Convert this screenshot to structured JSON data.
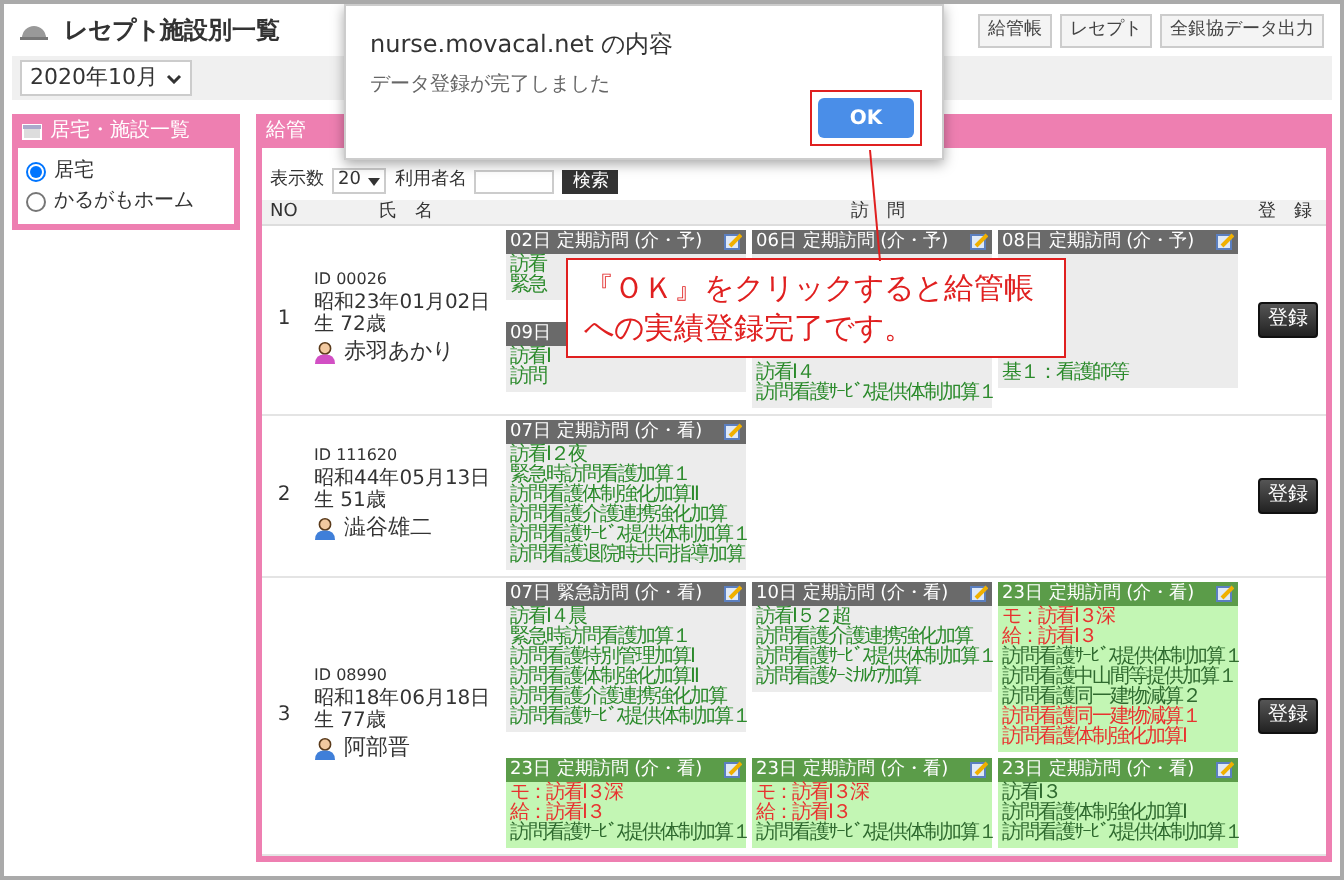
{
  "page": {
    "title": "レセプト施設別一覧",
    "header_buttons": [
      "給管帳",
      "レセプト",
      "全銀協データ出力"
    ],
    "month": "2020年10月"
  },
  "facility_panel": {
    "title": "居宅・施設一覧",
    "options": [
      {
        "label": "居宅",
        "selected": true
      },
      {
        "label": "かるがもホーム",
        "selected": false
      }
    ]
  },
  "main_panel": {
    "title": "給管",
    "toolbar": {
      "count_label": "表示数",
      "count": "20",
      "user_label": "利用者名",
      "search_button": "検索"
    },
    "columns": [
      "NO",
      "氏　名",
      "訪　問",
      "登　録"
    ],
    "rows": [
      {
        "no": "1",
        "id": "ID 00026",
        "birth": "昭和23年01月02日生 72歳",
        "name": "赤羽あかり",
        "color": "#d24fc4",
        "register_button": "登録",
        "callout": "『ＯＫ』をクリックすると給管帳への実績登録完了です。",
        "visits": [
          {
            "header": "02日 定期訪問 (介・予)",
            "done": false,
            "editable": true,
            "lines": [
              {
                "text": "訪看",
                "alert": false
              },
              {
                "text": "緊急",
                "alert": false
              }
            ]
          },
          {
            "header": "09日",
            "done": false,
            "lines": [
              {
                "text": "訪看I",
                "alert": false
              },
              {
                "text": "訪問",
                "alert": false
              }
            ]
          },
          {
            "header": "06日 定期訪問 (介・予)",
            "done": false,
            "editable": true,
            "lines": [
              {
                "text": "訪看I４",
                "alert": false
              },
              {
                "text": "訪問看護ｻｰﾋﾞｽ提供体制加算１",
                "alert": false
              }
            ]
          },
          {
            "header": "08日 定期訪問 (介・予)",
            "done": false,
            "editable": true,
            "lines": [
              {
                "text": "基１：看護師等",
                "alert": false
              }
            ]
          }
        ]
      },
      {
        "no": "2",
        "id": "ID 111620",
        "birth": "昭和44年05月13日生 51歳",
        "name": "澁谷雄二",
        "color": "#3f7fd9",
        "register_button": "登録",
        "visits": [
          {
            "header": "07日 定期訪問 (介・看)",
            "done": false,
            "editable": true,
            "lines": [
              {
                "text": "訪看I２夜",
                "alert": false
              },
              {
                "text": "緊急時訪問看護加算１",
                "alert": false
              },
              {
                "text": "訪問看護体制強化加算Ⅱ",
                "alert": false
              },
              {
                "text": "訪問看護介護連携強化加算",
                "alert": false
              },
              {
                "text": "訪問看護ｻｰﾋﾞｽ提供体制加算１",
                "alert": false
              },
              {
                "text": "訪問看護退院時共同指導加算",
                "alert": false
              }
            ]
          }
        ]
      },
      {
        "no": "3",
        "id": "ID 08990",
        "birth": "昭和18年06月18日生 77歳",
        "name": "阿部晋",
        "color": "#3f7fd9",
        "register_button": "登録",
        "visits": [
          {
            "header": "07日 緊急訪問 (介・看)",
            "done": false,
            "editable": true,
            "lines": [
              {
                "text": "訪看I４晨",
                "alert": false
              },
              {
                "text": "緊急時訪問看護加算１",
                "alert": false
              },
              {
                "text": "訪問看護特別管理加算Ⅰ",
                "alert": false
              },
              {
                "text": "訪問看護体制強化加算Ⅱ",
                "alert": false
              },
              {
                "text": "訪問看護介護連携強化加算",
                "alert": false
              },
              {
                "text": "訪問看護ｻｰﾋﾞｽ提供体制加算１",
                "alert": false
              }
            ]
          },
          {
            "header": "10日 定期訪問 (介・看)",
            "done": false,
            "editable": true,
            "lines": [
              {
                "text": "訪看I５２超",
                "alert": false
              },
              {
                "text": "訪問看護介護連携強化加算",
                "alert": false
              },
              {
                "text": "訪問看護ｻｰﾋﾞｽ提供体制加算１",
                "alert": false
              },
              {
                "text": "訪問看護ﾀｰﾐﾅﾙｹｱ加算",
                "alert": false
              }
            ]
          },
          {
            "header": "23日 定期訪問 (介・看)",
            "done": true,
            "editable": true,
            "lines": [
              {
                "text": "モ：訪看I３深",
                "alert": true
              },
              {
                "text": "給：訪看I３",
                "alert": true
              },
              {
                "text": "訪問看護ｻｰﾋﾞｽ提供体制加算１",
                "alert": false
              },
              {
                "text": "訪問看護中山間等提供加算１",
                "alert": false
              },
              {
                "text": "訪問看護同一建物減算２",
                "alert": false
              },
              {
                "text": "訪問看護同一建物減算１",
                "alert": true
              },
              {
                "text": "訪問看護体制強化加算Ⅰ",
                "alert": true
              }
            ]
          },
          {
            "header": "23日 定期訪問 (介・看)",
            "done": true,
            "editable": true,
            "lines": [
              {
                "text": "モ：訪看I３深",
                "alert": true
              },
              {
                "text": "給：訪看I３",
                "alert": true
              },
              {
                "text": "訪問看護ｻｰﾋﾞｽ提供体制加算１",
                "alert": false
              }
            ]
          },
          {
            "header": "23日 定期訪問 (介・看)",
            "done": true,
            "editable": true,
            "lines": [
              {
                "text": "モ：訪看I３深",
                "alert": true
              },
              {
                "text": "給：訪看I３",
                "alert": true
              },
              {
                "text": "訪問看護ｻｰﾋﾞｽ提供体制加算１",
                "alert": false
              }
            ]
          },
          {
            "header": "23日 定期訪問 (介・看)",
            "done": true,
            "editable": true,
            "lines": [
              {
                "text": "訪看I３",
                "alert": false
              },
              {
                "text": "訪問看護体制強化加算Ⅰ",
                "alert": false
              },
              {
                "text": "訪問看護ｻｰﾋﾞｽ提供体制加算１",
                "alert": false
              }
            ]
          }
        ]
      }
    ]
  },
  "dialog": {
    "title": "nurse.movacal.net の内容",
    "message": "データ登録が完了しました",
    "ok_button": "OK"
  }
}
